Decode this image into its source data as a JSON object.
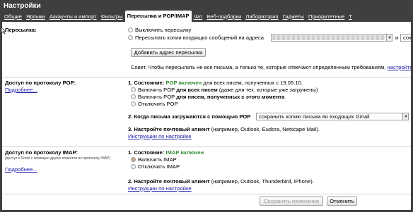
{
  "window": {
    "title": "Настройки"
  },
  "tabs": [
    {
      "label": "Общие"
    },
    {
      "label": "Ярлыки"
    },
    {
      "label": "Аккаунты и импорт"
    },
    {
      "label": "Фильтры"
    },
    {
      "label": "Пересылка и POP/IMAP",
      "active": true
    },
    {
      "label": "Чат"
    },
    {
      "label": "Веб-подборки"
    },
    {
      "label": "Лаборатория"
    },
    {
      "label": "Гаджеты"
    },
    {
      "label": "Приоритетные"
    },
    {
      "label": "Т"
    }
  ],
  "forwarding": {
    "label": "Пересылка:",
    "option_off": "Выключить пересылку",
    "option_forward": "Пересылать копии входящих сообщений на адреса",
    "and_text": "и",
    "keep_select": "сох",
    "add_button": "Добавить адрес пересылки",
    "tip_prefix": "Совет. Чтобы пересылать не все письма, а только те, которые отвечают определенным требованиям,",
    "tip_link": "настройте ф"
  },
  "pop": {
    "label": "Доступ по протоколу POP:",
    "more_link": "Подробнее...",
    "status_title": "1. Состояние:",
    "status_value": "POP включен",
    "status_rest": "для всех писем, полученных с 19.05.10.",
    "opt1_pre": "Включить POP",
    "opt1_bold": "для всех писем",
    "opt1_post": "(даже для тех, которые уже загружены)",
    "opt2_pre": "Включить POP",
    "opt2_bold": "для писем, полученных с этого момента",
    "opt3": "Отключить POP",
    "when_title": "2. Когда письма загружаются с помощью POP",
    "when_value": "сохранить копию письма во входящих Gmail",
    "client_title": "3. Настройте почтовый клиент",
    "client_rest": "(например, Outlook, Eudora, Netscape Mail).",
    "client_link": "Инструкции по настройке"
  },
  "imap": {
    "label": "Доступ по протоколу IMAP:",
    "note": "(доступ к Gmail с помощью других клиентов по протоколу IMAP)",
    "more_link": "Подробнее...",
    "status_title": "1. Состояние:",
    "status_value": "IMAP включен",
    "opt1": "Включить IMAP",
    "opt2": "Отключить IMAP",
    "client_title": "2. Настройте почтовый клиент",
    "client_rest": "(например, Outlook, Thunderbird, iPhone).",
    "client_link": "Инструкции по настройке"
  },
  "footer": {
    "save_label": "Сохранить изменения",
    "cancel_label": "Отменить"
  },
  "colors": {
    "frame": "#3f3f3f",
    "status_green": "#2e8b2e",
    "link": "#1c1ca8"
  }
}
